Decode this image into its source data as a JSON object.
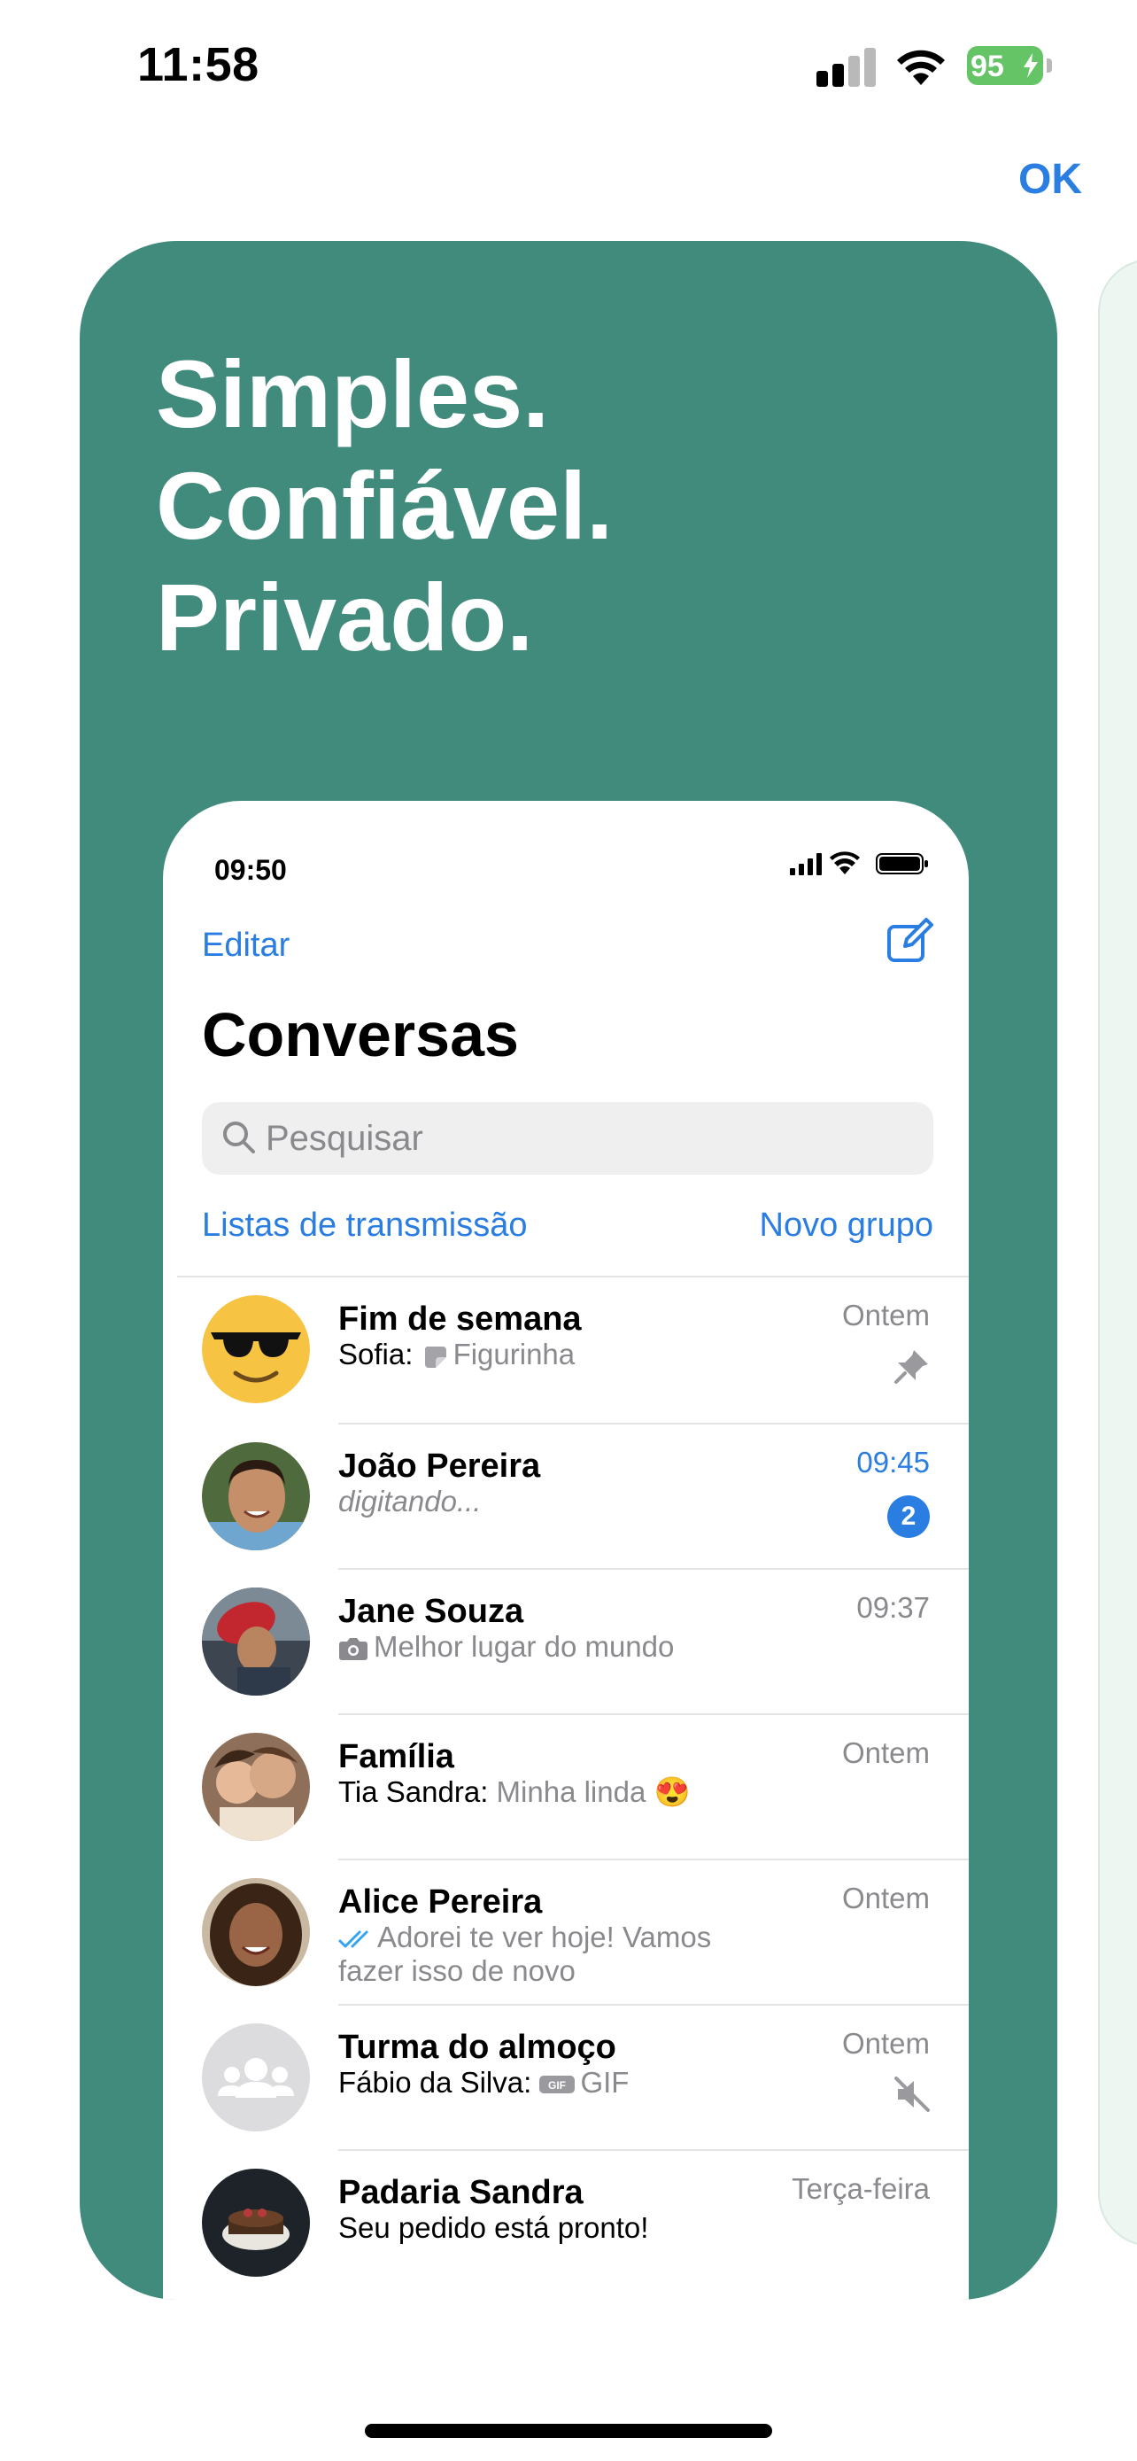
{
  "status_bar": {
    "time": "11:58",
    "battery": "95"
  },
  "top_action": {
    "ok_label": "OK"
  },
  "card": {
    "headline": [
      "Simples.",
      "Confiável.",
      "Privado."
    ],
    "bg_color": "#418b7d"
  },
  "phone": {
    "time": "09:50",
    "edit_label": "Editar",
    "title": "Conversas",
    "search_placeholder": "Pesquisar",
    "broadcast_label": "Listas de transmissão",
    "new_group_label": "Novo grupo",
    "chats": [
      {
        "name": "Fim de semana",
        "sender": "Sofia:",
        "message": "Figurinha",
        "time": "Ontem",
        "indicator": "pin-icon"
      },
      {
        "name": "João Pereira",
        "message": "digitando...",
        "time": "09:45",
        "unread": "2"
      },
      {
        "name": "Jane Souza",
        "message": "Melhor lugar do mundo",
        "time": "09:37",
        "indicator": "camera-icon"
      },
      {
        "name": "Família",
        "sender": "Tia Sandra:",
        "message": "Minha linda 😍",
        "time": "Ontem"
      },
      {
        "name": "Alice Pereira",
        "message_line1": "Adorei te ver hoje! Vamos",
        "message_line2": "fazer isso de novo",
        "time": "Ontem",
        "indicator": "double-check-icon"
      },
      {
        "name": "Turma do almoço",
        "sender": "Fábio da Silva:",
        "message": "GIF",
        "time": "Ontem",
        "indicator": "mute-icon"
      },
      {
        "name": "Padaria Sandra",
        "message": "Seu pedido está pronto!",
        "time": "Terça-feira"
      }
    ],
    "accent_color": "#2a7de1"
  }
}
